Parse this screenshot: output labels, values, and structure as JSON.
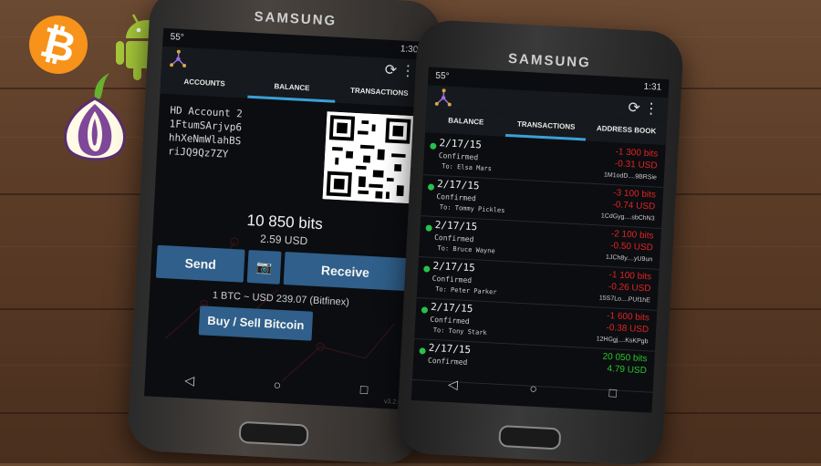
{
  "phone1": {
    "brand": "SAMSUNG",
    "status_left": "55°",
    "status_time": "1:30",
    "tabs": [
      "ACCOUNTS",
      "BALANCE",
      "TRANSACTIONS"
    ],
    "active_tab": "BALANCE",
    "account_name": "HD Account 2",
    "address_lines": [
      "1FtumSArjvp6",
      "hhXeNmWlahBS",
      "riJQ9Qz7ZY"
    ],
    "balance_bits": "10 850 bits",
    "balance_usd": "2.59 USD",
    "send_label": "Send",
    "receive_label": "Receive",
    "rate": "1 BTC ~ USD 239.07 (Bitfinex)",
    "buy_sell_label": "Buy / Sell Bitcoin",
    "version": "v3.2.0"
  },
  "phone2": {
    "brand": "SAMSUNG",
    "status_left": "55°",
    "status_time": "1:31",
    "tabs": [
      "BALANCE",
      "TRANSACTIONS",
      "ADDRESS BOOK"
    ],
    "active_tab": "TRANSACTIONS",
    "transactions": [
      {
        "date": "2/17/15",
        "status": "Confirmed",
        "to": "To: Elsa Mars",
        "bits": "-1 300 bits",
        "usd": "-0.31 USD",
        "addr": "1M1odD....9BRSie",
        "dir": "out"
      },
      {
        "date": "2/17/15",
        "status": "Confirmed",
        "to": "To: Tommy Pickles",
        "bits": "-3 100 bits",
        "usd": "-0.74 USD",
        "addr": "1CdGyg....sbChN3",
        "dir": "out"
      },
      {
        "date": "2/17/15",
        "status": "Confirmed",
        "to": "To: Bruce Wayne",
        "bits": "-2 100 bits",
        "usd": "-0.50 USD",
        "addr": "1JCh8y....yU9un",
        "dir": "out"
      },
      {
        "date": "2/17/15",
        "status": "Confirmed",
        "to": "To: Peter Parker",
        "bits": "-1 100 bits",
        "usd": "-0.26 USD",
        "addr": "15S7Lo....PUf1hE",
        "dir": "out"
      },
      {
        "date": "2/17/15",
        "status": "Confirmed",
        "to": "To: Tony Stark",
        "bits": "-1 600 bits",
        "usd": "-0.38 USD",
        "addr": "12HGgj....KsKPgb",
        "dir": "out"
      },
      {
        "date": "2/17/15",
        "status": "Confirmed",
        "to": "",
        "bits": "20 050 bits",
        "usd": "4.79 USD",
        "addr": "",
        "dir": "in"
      }
    ]
  },
  "colors": {
    "accent": "#3aa0d8",
    "button": "#2f5f8a",
    "negative": "#e02424",
    "positive": "#2ac42a",
    "bitcoin": "#f7931a",
    "android": "#a4c639",
    "tor": "#7e4798"
  },
  "icons": [
    "bitcoin-logo",
    "android-logo",
    "tor-onion-logo",
    "camera-icon",
    "refresh-icon",
    "overflow-menu-icon",
    "back-icon",
    "home-icon",
    "recents-icon"
  ]
}
